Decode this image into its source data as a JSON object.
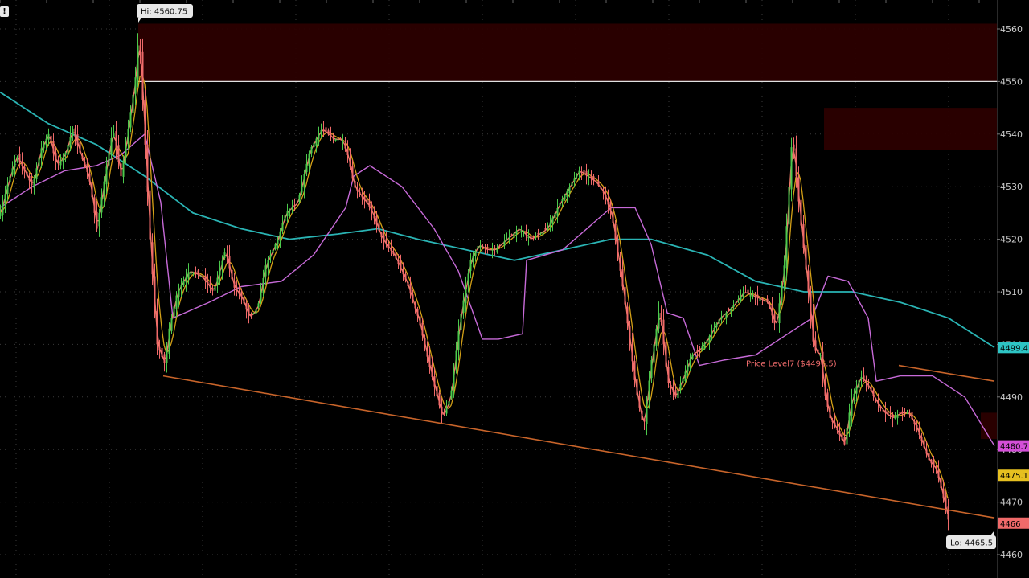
{
  "alert_icon": "exclamation-icon",
  "colors": {
    "background": "#000000",
    "grid": "#3a3a3a",
    "candle_up": "#4cc94c",
    "candle_down": "#f06a6a",
    "ma_fast": "#f07a6a",
    "ma_mid": "#d4a017",
    "ma_slow": "#c76ad8",
    "ma_long": "#2ab4b4",
    "zone_fill": "#2b0000",
    "channel_line": "#c8642a",
    "level_line": "#e0e0e0"
  },
  "chart_data": {
    "type": "line",
    "ylim": [
      4460,
      4562
    ],
    "y_ticks": [
      4460,
      4470,
      4480,
      4490,
      4500,
      4510,
      4520,
      4530,
      4540,
      4550,
      4560
    ],
    "x": [
      0,
      10,
      20,
      30,
      40,
      50,
      60,
      70,
      80,
      90,
      100,
      110,
      120,
      130,
      140,
      150,
      160,
      170,
      172,
      180,
      186,
      195,
      205,
      210,
      220,
      235,
      250,
      265,
      280,
      290,
      300,
      310,
      320,
      330,
      345,
      355,
      370,
      385,
      400,
      415,
      425,
      432,
      440,
      460,
      475,
      490,
      505,
      520,
      535,
      550,
      560,
      572,
      585,
      595,
      605,
      615,
      630,
      645,
      660,
      680,
      700,
      720,
      740,
      750,
      760,
      775,
      790,
      800,
      810,
      820,
      830,
      840,
      850,
      860,
      870,
      880,
      895,
      910,
      925,
      940,
      955,
      965,
      975,
      985,
      995,
      1005,
      1012,
      1020,
      1025,
      1032,
      1040,
      1050,
      1058,
      1063,
      1070,
      1080,
      1090,
      1100,
      1110,
      1120,
      1130,
      1140,
      1155,
      1165,
      1180,
      1195,
      1210,
      1225,
      1237
    ],
    "series": [
      {
        "values": [
          4525,
          4531,
          4536,
          4533,
          4530,
          4537,
          4540,
          4534,
          4536,
          4541,
          4536,
          4532,
          4522,
          4532,
          4541,
          4532,
          4542,
          4553,
          4560.75,
          4538,
          4520,
          4500,
          4496,
          4503,
          4510,
          4514,
          4513,
          4510,
          4518,
          4511,
          4509,
          4505,
          4507,
          4515,
          4520,
          4525,
          4527,
          4537,
          4541,
          4539,
          4539,
          4536,
          4530,
          4526,
          4520,
          4517,
          4512,
          4505,
          4495,
          4486,
          4490,
          4505,
          4516,
          4519,
          4518,
          4518,
          4520,
          4522,
          4520,
          4522,
          4528,
          4533,
          4531,
          4529,
          4525,
          4510,
          4492,
          4484,
          4497,
          4507,
          4493,
          4490,
          4494,
          4498,
          4499,
          4501,
          4505,
          4507,
          4510,
          4509,
          4508,
          4503,
          4515,
          4540,
          4524,
          4510,
          4499,
          4498,
          4491,
          4486,
          4484,
          4481,
          4489,
          4491,
          4494,
          4492,
          4489,
          4487,
          4486,
          4487,
          4487,
          4484,
          4478,
          4476,
          4466
        ]
      }
    ]
  },
  "overlay_lines": {
    "ma_long": [
      [
        0,
        4548
      ],
      [
        60,
        4542
      ],
      [
        120,
        4538
      ],
      [
        180,
        4532
      ],
      [
        240,
        4525
      ],
      [
        300,
        4522
      ],
      [
        360,
        4520
      ],
      [
        420,
        4521
      ],
      [
        470,
        4522
      ],
      [
        520,
        4520
      ],
      [
        580,
        4518
      ],
      [
        640,
        4516
      ],
      [
        700,
        4518
      ],
      [
        760,
        4520
      ],
      [
        810,
        4520
      ],
      [
        880,
        4517
      ],
      [
        940,
        4512
      ],
      [
        1000,
        4510
      ],
      [
        1060,
        4510
      ],
      [
        1120,
        4508
      ],
      [
        1180,
        4505
      ],
      [
        1237,
        4499.4
      ]
    ],
    "ma_slow": [
      [
        0,
        4526
      ],
      [
        40,
        4530
      ],
      [
        80,
        4533
      ],
      [
        120,
        4534
      ],
      [
        150,
        4536
      ],
      [
        180,
        4540
      ],
      [
        200,
        4527
      ],
      [
        215,
        4505
      ],
      [
        260,
        4508
      ],
      [
        300,
        4511
      ],
      [
        350,
        4512
      ],
      [
        390,
        4517
      ],
      [
        430,
        4526
      ],
      [
        440,
        4532
      ],
      [
        460,
        4534
      ],
      [
        500,
        4530
      ],
      [
        540,
        4522
      ],
      [
        570,
        4514
      ],
      [
        600,
        4501
      ],
      [
        620,
        4501
      ],
      [
        650,
        4502
      ],
      [
        655,
        4516
      ],
      [
        700,
        4518
      ],
      [
        760,
        4526
      ],
      [
        790,
        4526
      ],
      [
        810,
        4519
      ],
      [
        830,
        4506
      ],
      [
        850,
        4505
      ],
      [
        870,
        4496
      ],
      [
        900,
        4497
      ],
      [
        940,
        4498
      ],
      [
        980,
        4502
      ],
      [
        1010,
        4505
      ],
      [
        1030,
        4513
      ],
      [
        1055,
        4512
      ],
      [
        1080,
        4505
      ],
      [
        1090,
        4493
      ],
      [
        1120,
        4494
      ],
      [
        1160,
        4494
      ],
      [
        1200,
        4490
      ],
      [
        1237,
        4480.7
      ]
    ]
  },
  "zones": [
    {
      "x_start": 172,
      "y_low": 4550,
      "y_high": 4561
    },
    {
      "x_start": 1025,
      "y_low": 4537,
      "y_high": 4545
    },
    {
      "x_start": 1220,
      "y_low": 4482,
      "y_high": 4487
    }
  ],
  "trendlines": [
    {
      "points": [
        [
          203,
          4494
        ],
        [
          1237,
          4467
        ]
      ]
    },
    {
      "points": [
        [
          1118,
          4496
        ],
        [
          1237,
          4493
        ]
      ]
    }
  ],
  "level_line": {
    "value": 4550,
    "x_start": 172
  },
  "price_level": {
    "label": "Price Level7 ($4496.5)",
    "value": 4496.5,
    "x": 928
  },
  "hi_label": {
    "text": "Hi: 4560.75",
    "x": 172,
    "value": 4560.75
  },
  "lo_label": {
    "text": "Lo: 4465.5",
    "x": 1237,
    "value": 4465.5
  },
  "price_badges": [
    {
      "text": "4499.4",
      "value": 4499.4,
      "color": "#2ec5c5"
    },
    {
      "text": "4480.7",
      "value": 4480.7,
      "color": "#d44fd8"
    },
    {
      "text": "4475.1",
      "value": 4475.1,
      "color": "#e6c020"
    },
    {
      "text": "4466",
      "value": 4466,
      "color": "#f06a6a"
    }
  ]
}
